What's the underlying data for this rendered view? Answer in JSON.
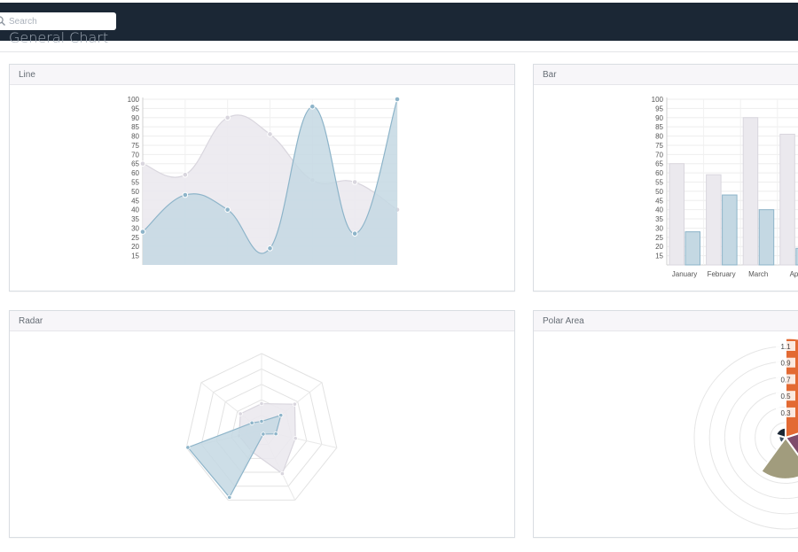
{
  "search": {
    "placeholder": "Search",
    "icon": "search-icon"
  },
  "page_title": "General Chart",
  "panels": {
    "line": {
      "title": "Line"
    },
    "bar": {
      "title": "Bar"
    },
    "radar": {
      "title": "Radar"
    },
    "polar": {
      "title": "Polar Area"
    }
  },
  "colors": {
    "series_a_fill": "#ebe9ee",
    "series_a_stroke": "#d9d6de",
    "series_b_fill": "#c4d8e3",
    "series_b_stroke": "#8db4c9",
    "polar": [
      "#e36a33",
      "#7f4c6c",
      "#a19c7d",
      "#3f5366",
      "#1b2735"
    ]
  },
  "chart_data": [
    {
      "type": "area",
      "yticks": [
        15,
        20,
        25,
        30,
        35,
        40,
        45,
        50,
        55,
        60,
        65,
        70,
        75,
        80,
        85,
        90,
        95,
        100
      ],
      "ylim": [
        10,
        100
      ],
      "categories_count": 7,
      "series": [
        {
          "values": [
            65,
            59,
            90,
            81,
            56,
            55,
            40
          ]
        },
        {
          "values": [
            28,
            48,
            40,
            19,
            96,
            27,
            100
          ]
        }
      ]
    },
    {
      "type": "bar",
      "categories": [
        "January",
        "February",
        "March",
        "Apr"
      ],
      "yticks": [
        15,
        20,
        25,
        30,
        35,
        40,
        45,
        50,
        55,
        60,
        65,
        70,
        75,
        80,
        85,
        90,
        95,
        100
      ],
      "ylim": [
        10,
        100
      ],
      "series": [
        {
          "values": [
            65,
            59,
            90,
            81
          ]
        },
        {
          "values": [
            28,
            48,
            40,
            19
          ]
        }
      ]
    },
    {
      "type": "radar",
      "axes_count": 7,
      "max": 100,
      "series": [
        {
          "values": [
            35,
            55,
            45,
            62,
            30,
            30,
            35
          ]
        },
        {
          "values": [
            12,
            32,
            19,
            5,
            96,
            98,
            16
          ]
        }
      ]
    },
    {
      "type": "polar",
      "ticks": [
        "0.3",
        "0.5",
        "0.7",
        "0.9",
        "1.1"
      ],
      "max": 1.1,
      "values": [
        1.2,
        0.55,
        0.5,
        0.08,
        0.12
      ]
    }
  ]
}
